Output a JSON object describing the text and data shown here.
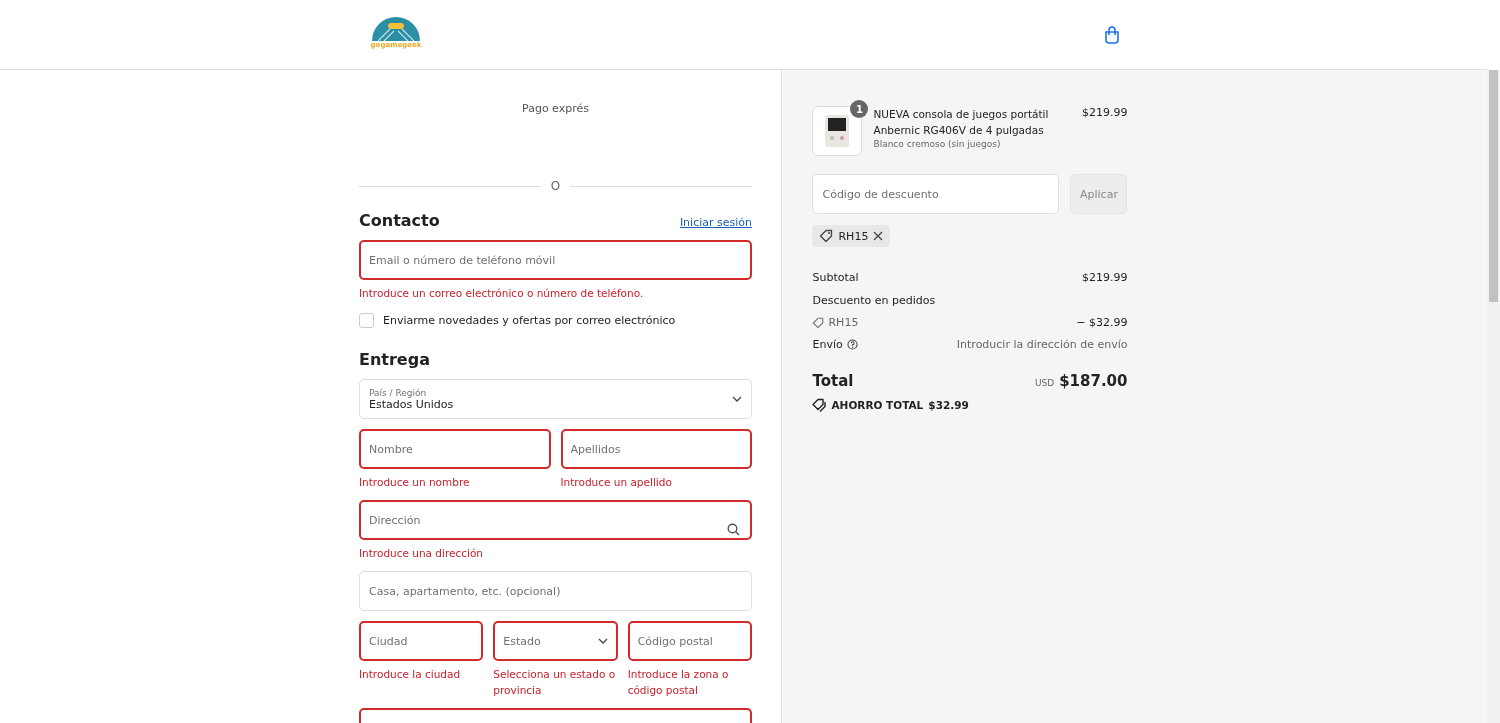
{
  "header": {
    "logo_text": "gogamegeek"
  },
  "express": {
    "title": "Pago exprés",
    "divider_label": "O"
  },
  "contact": {
    "heading": "Contacto",
    "login_link": "Iniciar sesión",
    "field": {
      "placeholder": "Email o número de teléfono móvil",
      "invalid": true,
      "error": "Introduce un correo electrónico o número de teléfono."
    },
    "newsletter": {
      "label": "Enviarme novedades y ofertas por correo electrónico",
      "checked": false
    }
  },
  "delivery": {
    "heading": "Entrega",
    "rows": [
      [
        {
          "kind": "select",
          "label": "País / Región",
          "value": "Estados Unidos",
          "invalid": false
        }
      ],
      [
        {
          "kind": "text",
          "placeholder": "Nombre",
          "invalid": true,
          "error": "Introduce un nombre"
        },
        {
          "kind": "text",
          "placeholder": "Apellidos",
          "invalid": true,
          "error": "Introduce un apellido"
        }
      ],
      [
        {
          "kind": "search",
          "placeholder": "Dirección",
          "invalid": true,
          "error": "Introduce una dirección"
        }
      ],
      [
        {
          "kind": "text",
          "placeholder": "Casa, apartamento, etc. (opcional)",
          "invalid": false
        }
      ],
      [
        {
          "kind": "text",
          "placeholder": "Ciudad",
          "invalid": true,
          "error": "Introduce la ciudad"
        },
        {
          "kind": "select",
          "placeholder": "Estado",
          "invalid": true,
          "error": "Selecciona un estado o provincia"
        },
        {
          "kind": "text",
          "placeholder": "Código postal",
          "invalid": true,
          "error": "Introduce la zona o código postal"
        }
      ],
      [
        {
          "kind": "text",
          "invalid": true
        }
      ]
    ]
  },
  "summary": {
    "product": {
      "quantity": "1",
      "name": "NUEVA consola de juegos portátil Anbernic RG406V de 4 pulgadas",
      "variant": "Blanco cremoso (sin juegos)",
      "price": "$219.99"
    },
    "discount": {
      "placeholder": "Código de descuento",
      "button": "Aplicar",
      "disabled": true,
      "tags": [
        "RH15"
      ]
    },
    "subtotal": {
      "label": "Subtotal",
      "value": "$219.99"
    },
    "order_discount": {
      "label": "Descuento en pedidos",
      "code": "RH15",
      "value": "− $32.99"
    },
    "shipping": {
      "label": "Envío",
      "value": "Introducir la dirección de envío"
    },
    "total": {
      "label": "Total",
      "currency": "USD",
      "value": "$187.00"
    },
    "savings": {
      "label": "AHORRO TOTAL",
      "value": "$32.99"
    }
  }
}
